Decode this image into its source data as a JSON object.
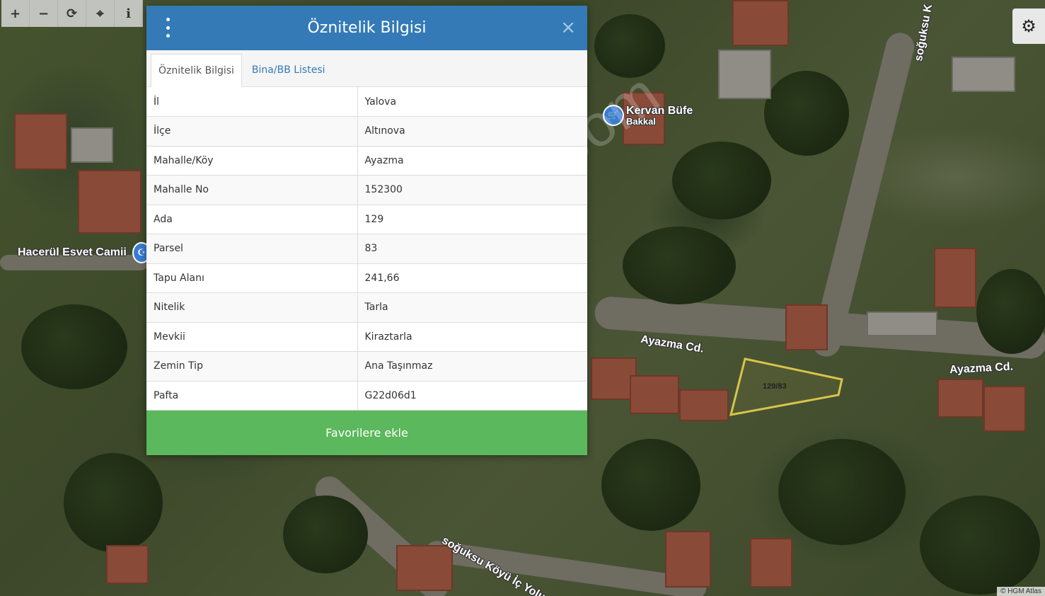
{
  "toolbar": {
    "zoom_in": "+",
    "zoom_out": "−",
    "refresh": "⟳",
    "locate": "⌖",
    "info": "i"
  },
  "settings_icon": "gear-icon",
  "popup": {
    "title": "Öznitelik Bilgisi",
    "close": "×",
    "tabs": [
      {
        "label": "Öznitelik Bilgisi",
        "active": true
      },
      {
        "label": "Bina/BB Listesi",
        "active": false
      }
    ],
    "rows": [
      {
        "key": "İl",
        "value": "Yalova"
      },
      {
        "key": "İlçe",
        "value": "Altınova"
      },
      {
        "key": "Mahalle/Köy",
        "value": "Ayazma"
      },
      {
        "key": "Mahalle No",
        "value": "152300"
      },
      {
        "key": "Ada",
        "value": "129"
      },
      {
        "key": "Parsel",
        "value": "83"
      },
      {
        "key": "Tapu Alanı",
        "value": "241,66"
      },
      {
        "key": "Nitelik",
        "value": "Tarla"
      },
      {
        "key": "Mevkii",
        "value": "Kiraztarla"
      },
      {
        "key": "Zemin Tip",
        "value": "Ana Taşınmaz"
      },
      {
        "key": "Pafta",
        "value": "G22d06d1"
      }
    ],
    "favorite_button": "Favorilere ekle"
  },
  "map": {
    "labels": {
      "poi_name": "Kervan Büfe",
      "poi_type": "Bakkal",
      "mosque": "Hacerül Esvet Camii",
      "street1": "Ayazma Cd.",
      "street2": "Ayazma Cd.",
      "road_south": "soğuksu Köyü İç Yolu",
      "road_north": "soğuksu K"
    },
    "parcel_label": "129/83",
    "watermark": "emlakjet.com",
    "attribution": "© HGM Atlas"
  },
  "colors": {
    "header": "#337ab7",
    "favorite": "#5cb85c",
    "parcel_outline": "#d8c44a"
  }
}
